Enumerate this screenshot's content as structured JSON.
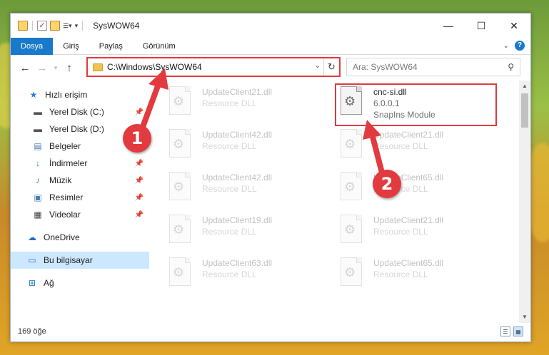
{
  "window": {
    "title": "SysWOW64"
  },
  "ribbon": {
    "tabs": [
      "Dosya",
      "Giriş",
      "Paylaş",
      "Görünüm"
    ],
    "help_label": "?"
  },
  "navigation": {
    "address": "C:\\Windows\\SysWOW64",
    "search_placeholder": "Ara: SysWOW64"
  },
  "sidebar": {
    "items": [
      {
        "label": "Hızlı erişim",
        "icon": "star-icon"
      },
      {
        "label": "Yerel Disk (C:)",
        "icon": "drive-icon",
        "pinned": true
      },
      {
        "label": "Yerel Disk (D:)",
        "icon": "drive-icon"
      },
      {
        "label": "Belgeler",
        "icon": "document-icon"
      },
      {
        "label": "İndirmeler",
        "icon": "download-icon",
        "pinned": true
      },
      {
        "label": "Müzik",
        "icon": "music-icon",
        "pinned": true
      },
      {
        "label": "Resimler",
        "icon": "pictures-icon",
        "pinned": true
      },
      {
        "label": "Videolar",
        "icon": "video-icon",
        "pinned": true
      },
      {
        "label": "OneDrive",
        "icon": "cloud-icon"
      },
      {
        "label": "Bu bilgisayar",
        "icon": "computer-icon",
        "selected": true
      },
      {
        "label": "Ağ",
        "icon": "network-icon"
      }
    ]
  },
  "files": {
    "left_column": [
      {
        "name": "UpdateClient21.dll",
        "type": "Resource DLL"
      },
      {
        "name": "UpdateClient42.dll",
        "type": "Resource DLL"
      },
      {
        "name": "UpdateClient42.dll",
        "type": "Resource DLL"
      },
      {
        "name": "UpdateClient19.dll",
        "type": "Resource DLL"
      },
      {
        "name": "UpdateClient63.dll",
        "type": "Resource DLL"
      }
    ],
    "right_column": [
      {
        "name": "cnc-si.dll",
        "version": "6.0.0.1",
        "type": "SnapIns Module",
        "highlighted": true
      },
      {
        "name": "UpdateClient21.dll",
        "type": "Resource DLL"
      },
      {
        "name": "UpdateClient65.dll",
        "type": "Resource DLL"
      },
      {
        "name": "UpdateClient21.dll",
        "type": "Resource DLL"
      },
      {
        "name": "UpdateClient65.dll",
        "type": "Resource DLL"
      }
    ]
  },
  "status": {
    "item_count": "169 öğe"
  },
  "annotations": {
    "badge_1": "1",
    "badge_2": "2",
    "color": "#e23a3f"
  }
}
